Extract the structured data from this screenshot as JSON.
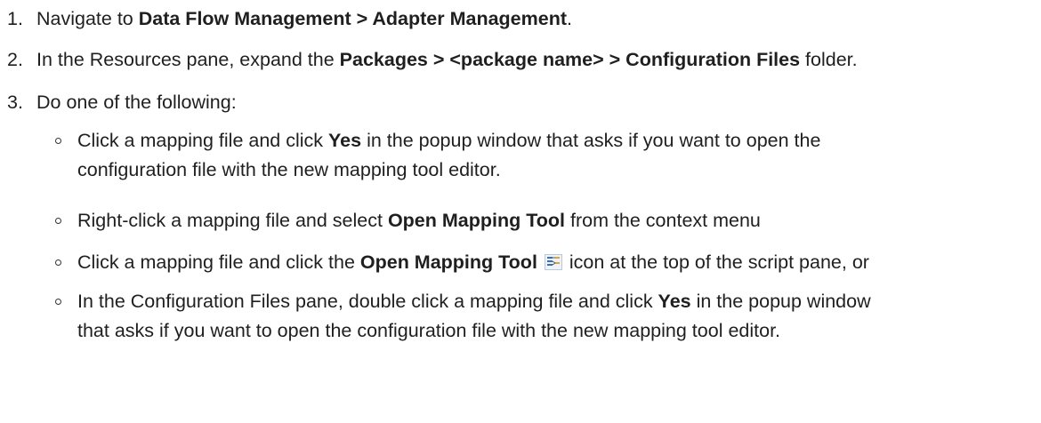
{
  "steps": [
    {
      "num": "1.",
      "parts": [
        "Navigate to ",
        "Data Flow Management > Adapter Management",
        "."
      ]
    },
    {
      "num": "2.",
      "parts": [
        "In the Resources pane, expand the ",
        "Packages > <package name> > Configuration Files",
        " folder."
      ]
    },
    {
      "num": "3.",
      "parts": [
        "Do one of the following:"
      ]
    }
  ],
  "bullets": [
    {
      "parts": [
        "Click a mapping file and click ",
        "Yes",
        " in the popup window that asks if you want to open the",
        "configuration file with the new mapping tool editor."
      ]
    },
    {
      "parts": [
        "Right-click a mapping file and select ",
        "Open Mapping Tool",
        " from the context menu"
      ]
    },
    {
      "parts": [
        "Click a mapping file and click the ",
        "Open Mapping Tool",
        "icon at the top of the script pane, or"
      ],
      "icon": "mapping-tool-icon"
    },
    {
      "parts": [
        "In the Configuration Files pane, double click a mapping file and click ",
        "Yes",
        " in the popup window",
        "that asks if you want to open the configuration file with the new mapping tool editor."
      ]
    }
  ]
}
